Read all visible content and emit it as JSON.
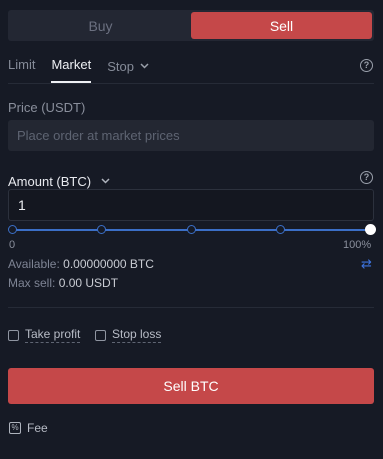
{
  "side_toggle": {
    "buy": "Buy",
    "sell": "Sell"
  },
  "order_tabs": [
    {
      "label": "Limit"
    },
    {
      "label": "Market"
    },
    {
      "label": "Stop"
    }
  ],
  "price": {
    "label": "Price (USDT)",
    "placeholder": "Place order at market prices"
  },
  "amount": {
    "label": "Amount (BTC)",
    "value": "1"
  },
  "slider": {
    "min_label": "0",
    "max_label": "100%",
    "level": 1.0,
    "stops": [
      0,
      0.25,
      0.5,
      0.75,
      1.0
    ]
  },
  "available": {
    "label": "Available:",
    "value": "0.00000000 BTC"
  },
  "max_sell": {
    "label": "Max sell:",
    "value": "0.00 USDT"
  },
  "options": {
    "take_profit": "Take profit",
    "stop_loss": "Stop loss"
  },
  "submit": {
    "label": "Sell BTC"
  },
  "fee": {
    "label": "Fee"
  },
  "colors": {
    "sell": "#c54849",
    "accent_blue": "#3b6fc7",
    "background": "#161a25"
  },
  "icons": [
    "chevron-down-icon",
    "help-icon",
    "swap-icon",
    "fee-icon"
  ]
}
